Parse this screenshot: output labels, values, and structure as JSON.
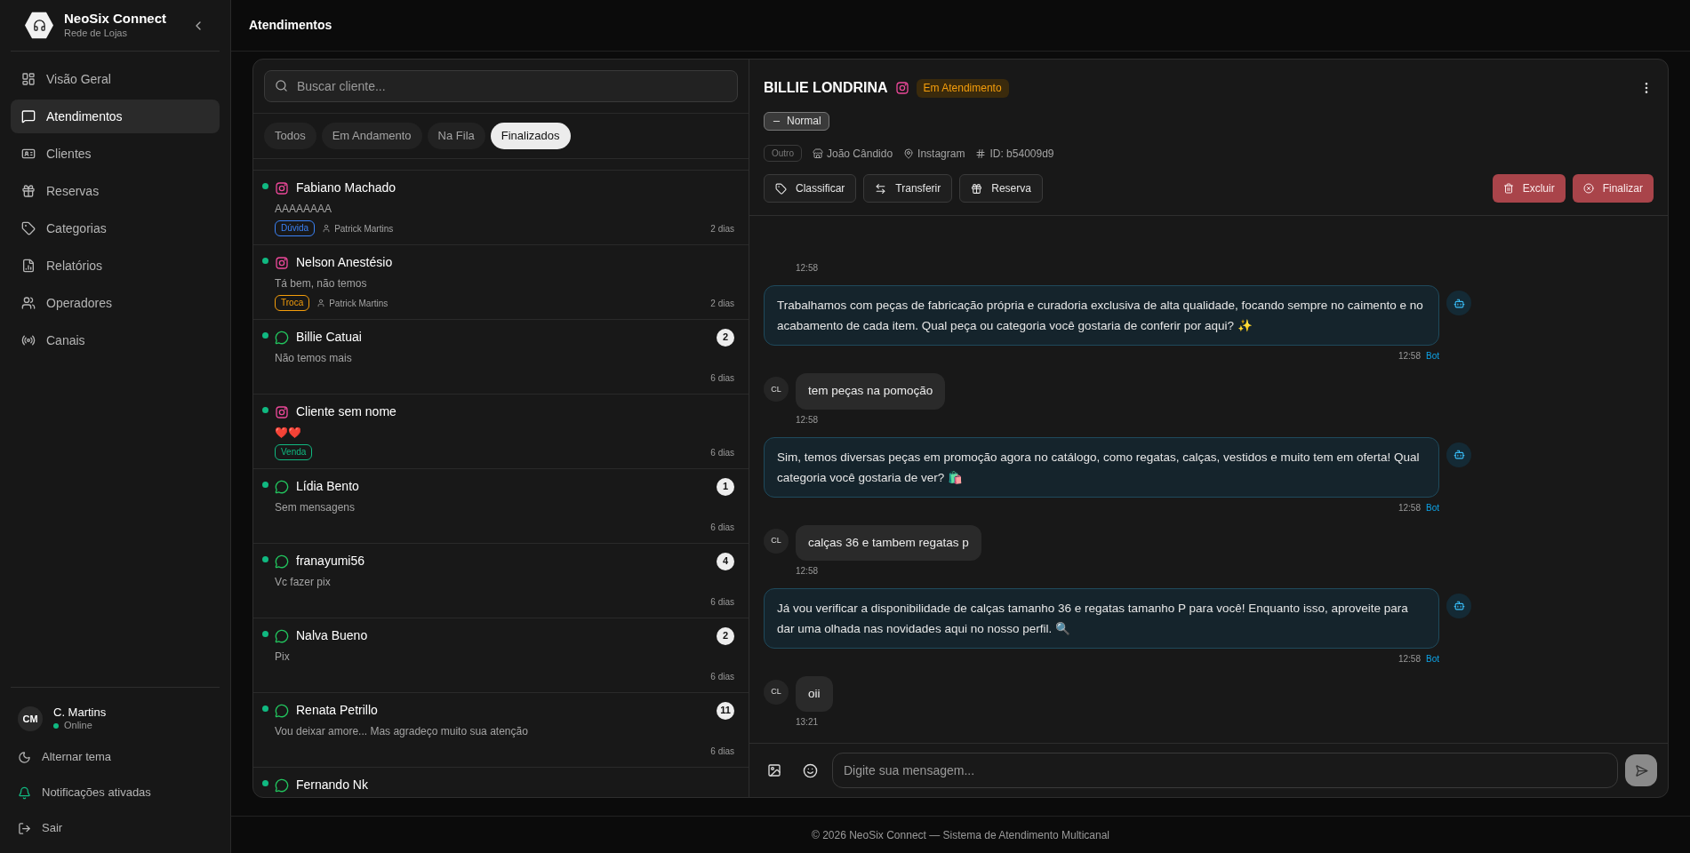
{
  "brand": {
    "name": "NeoSix Connect",
    "subtitle": "Rede de Lojas"
  },
  "nav": [
    {
      "label": "Visão Geral",
      "selected": false
    },
    {
      "label": "Atendimentos",
      "selected": true
    },
    {
      "label": "Clientes",
      "selected": false
    },
    {
      "label": "Reservas",
      "selected": false
    },
    {
      "label": "Categorias",
      "selected": false
    },
    {
      "label": "Relatórios",
      "selected": false
    },
    {
      "label": "Operadores",
      "selected": false
    },
    {
      "label": "Canais",
      "selected": false
    }
  ],
  "user": {
    "initials": "CM",
    "name": "C. Martins",
    "status": "Online",
    "online": true
  },
  "bottom_actions": [
    {
      "label": "Alternar tema",
      "active": false
    },
    {
      "label": "Notificações ativadas",
      "active": true
    },
    {
      "label": "Sair",
      "active": false
    }
  ],
  "page_title": "Atendimentos",
  "search": {
    "placeholder": "Buscar cliente..."
  },
  "filters": [
    {
      "label": "Todos",
      "selected": false
    },
    {
      "label": "Em Andamento",
      "selected": false
    },
    {
      "label": "Na Fila",
      "selected": false
    },
    {
      "label": "Finalizados",
      "selected": true
    }
  ],
  "conversations": [
    {
      "kind": "instagram",
      "name": "Fabiano Machado",
      "preview": "AAAAAAAA",
      "tag": {
        "label": "Dúvida",
        "color": "#3b82f6"
      },
      "operator": "Patrick Martins",
      "time": "2 dias"
    },
    {
      "kind": "instagram",
      "name": "Nelson Anestésio",
      "preview": "Tá bem, não temos",
      "tag": {
        "label": "Troca",
        "color": "#f59e0b"
      },
      "operator": "Patrick Martins",
      "time": "2 dias"
    },
    {
      "kind": "whatsapp",
      "name": "Billie Catuai",
      "preview": "Não temos mais",
      "unread": "2",
      "time": "6 dias"
    },
    {
      "kind": "instagram",
      "name": "Cliente sem nome",
      "preview": "❤️❤️",
      "tag": {
        "label": "Venda",
        "color": "#10b981"
      },
      "time": "6 dias"
    },
    {
      "kind": "whatsapp",
      "name": "Lídia Bento",
      "preview": "Sem mensagens",
      "unread": "1",
      "time": "6 dias"
    },
    {
      "kind": "whatsapp",
      "name": "franayumi56",
      "preview": "Vc fazer pix",
      "unread": "4",
      "time": "6 dias"
    },
    {
      "kind": "whatsapp",
      "name": "Nalva Bueno",
      "preview": "Pix",
      "unread": "2",
      "time": "6 dias"
    },
    {
      "kind": "whatsapp",
      "name": "Renata Petrillo",
      "preview": "Vou deixar amore... Mas agradeço muito sua atenção",
      "unread": "11",
      "time": "6 dias"
    },
    {
      "kind": "whatsapp",
      "name": "Fernando Nk"
    }
  ],
  "chat": {
    "name": "BILLIE LONDRINA",
    "kind": "instagram",
    "status": "Em Atendimento",
    "priority": "Normal",
    "category": "Outro",
    "store": "João Cândido",
    "source": "Instagram",
    "id": "ID: b54009d9",
    "actions": [
      "Classificar",
      "Transferir",
      "Reserva"
    ],
    "danger_actions": [
      "Excluir",
      "Finalizar"
    ],
    "messages": [
      {
        "kind": "client",
        "time": "12:58"
      },
      {
        "kind": "bot",
        "text": "Trabalhamos com peças de fabricação própria e curadoria exclusiva de alta qualidade, focando sempre no caimento e no acabamento de cada item. Qual peça ou categoria você gostaria de conferir por aqui? ✨",
        "time": "12:58",
        "sender": "Bot"
      },
      {
        "kind": "client",
        "avatar": "CL",
        "text": "tem peças na pomoção",
        "time": "12:58"
      },
      {
        "kind": "bot",
        "text": "Sim, temos diversas peças em promoção agora no catálogo, como regatas, calças, vestidos e muito tem em oferta! Qual categoria você gostaria de ver? 🛍️",
        "time": "12:58",
        "sender": "Bot"
      },
      {
        "kind": "client",
        "avatar": "CL",
        "text": "calças 36 e tambem regatas p",
        "time": "12:58"
      },
      {
        "kind": "bot",
        "text": "Já vou verificar a disponibilidade de calças tamanho 36 e regatas tamanho P para você! Enquanto isso, aproveite para dar uma olhada nas novidades aqui no nosso perfil. 🔍",
        "time": "12:58",
        "sender": "Bot"
      },
      {
        "kind": "client",
        "avatar": "CL",
        "text": "oii",
        "time": "13:21"
      }
    ],
    "composer": {
      "placeholder": "Digite sua mensagem..."
    }
  },
  "footer": "© 2026 NeoSix Connect — Sistema de Atendimento Multicanal"
}
